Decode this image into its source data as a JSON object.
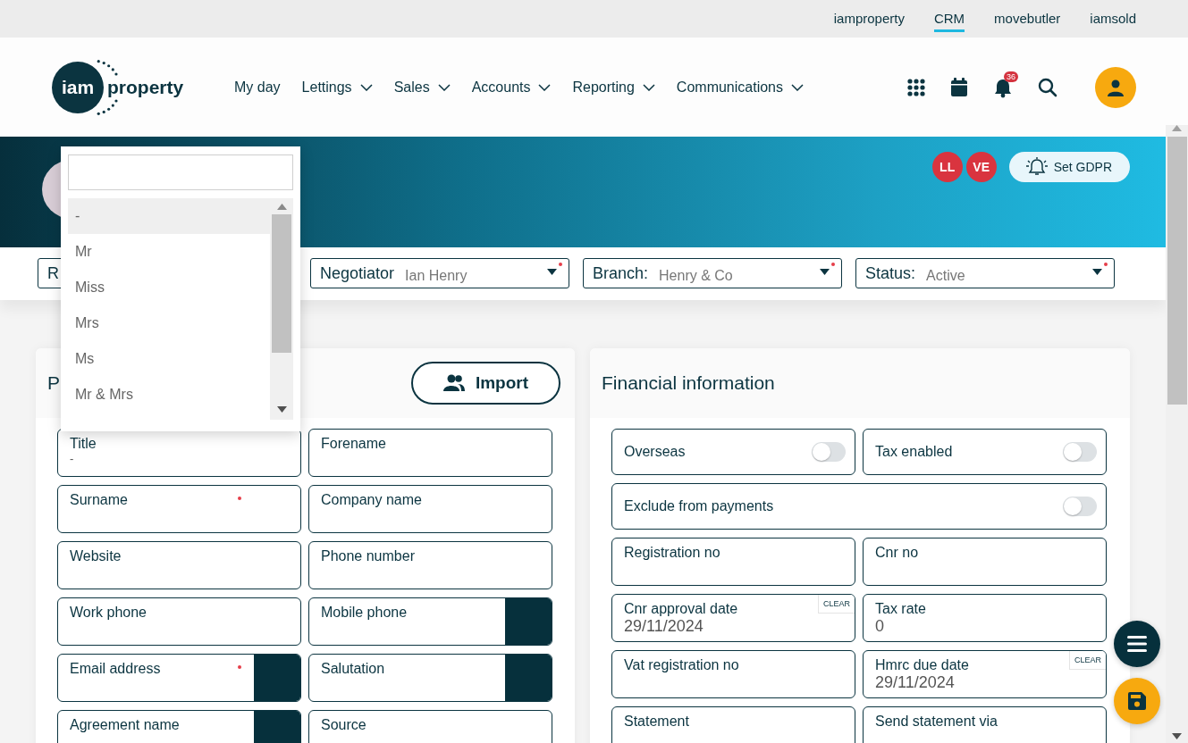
{
  "top_links": [
    {
      "label": "iamproperty",
      "selected": false
    },
    {
      "label": "CRM",
      "selected": true
    },
    {
      "label": "movebutler",
      "selected": false
    },
    {
      "label": "iamsold",
      "selected": false
    }
  ],
  "logo": {
    "mark": "iam",
    "word": "property"
  },
  "nav": [
    {
      "label": "My day",
      "has_menu": false
    },
    {
      "label": "Lettings",
      "has_menu": true
    },
    {
      "label": "Sales",
      "has_menu": true
    },
    {
      "label": "Accounts",
      "has_menu": true
    },
    {
      "label": "Reporting",
      "has_menu": true
    },
    {
      "label": "Communications",
      "has_menu": true
    }
  ],
  "notification_count": "36",
  "header": {
    "badges": [
      "LL",
      "VE"
    ],
    "gdpr_button": "Set GDPR"
  },
  "selects": [
    {
      "label": "R",
      "required": false
    },
    {
      "label": "Negotiator",
      "value": "Ian Henry",
      "required": true
    },
    {
      "label": "Branch:",
      "value": "Henry & Co",
      "required": true
    },
    {
      "label": "Status:",
      "value": "Active",
      "required": true
    }
  ],
  "personal_card": {
    "title": "P",
    "import_button": "Import",
    "fields": [
      {
        "kind": "text",
        "label": "Title",
        "value": "-",
        "required": false,
        "action_button": false
      },
      {
        "kind": "text",
        "label": "Forename",
        "required": false,
        "action_button": false
      },
      {
        "kind": "text",
        "label": "Surname",
        "required": true,
        "action_button": false
      },
      {
        "kind": "text",
        "label": "Company name",
        "required": false,
        "action_button": false
      },
      {
        "kind": "text",
        "label": "Website",
        "required": false,
        "action_button": false
      },
      {
        "kind": "text",
        "label": "Phone number",
        "required": false,
        "action_button": false
      },
      {
        "kind": "text",
        "label": "Work phone",
        "required": false,
        "action_button": false
      },
      {
        "kind": "text",
        "label": "Mobile phone",
        "required": false,
        "action_button": true
      },
      {
        "kind": "text",
        "label": "Email address",
        "required": true,
        "action_button": true
      },
      {
        "kind": "text",
        "label": "Salutation",
        "required": false,
        "action_button": true
      },
      {
        "kind": "text",
        "label": "Agreement name",
        "required": false,
        "action_button": true
      },
      {
        "kind": "text",
        "label": "Source",
        "required": false,
        "action_button": false
      }
    ]
  },
  "financial_card": {
    "title": "Financial information",
    "fields": [
      {
        "kind": "toggle",
        "label": "Overseas",
        "on": false
      },
      {
        "kind": "toggle",
        "label": "Tax enabled",
        "on": false
      },
      {
        "kind": "toggle",
        "label": "Exclude from payments",
        "on": false,
        "wide": true
      },
      {
        "kind": "text",
        "label": "Registration no"
      },
      {
        "kind": "text",
        "label": "Cnr no"
      },
      {
        "kind": "date",
        "label": "Cnr approval date",
        "value": "29/11/2024",
        "clear": "CLEAR"
      },
      {
        "kind": "text",
        "label": "Tax rate",
        "value": "0"
      },
      {
        "kind": "text",
        "label": "Vat registration no"
      },
      {
        "kind": "date",
        "label": "Hmrc due date",
        "value": "29/11/2024",
        "clear": "CLEAR"
      },
      {
        "kind": "text",
        "label": "Statement"
      },
      {
        "kind": "text",
        "label": "Send statement via"
      }
    ]
  },
  "title_dropdown": {
    "options": [
      {
        "label": "-",
        "selected": true
      },
      {
        "label": "Mr",
        "selected": false
      },
      {
        "label": "Miss",
        "selected": false
      },
      {
        "label": "Mrs",
        "selected": false
      },
      {
        "label": "Ms",
        "selected": false
      },
      {
        "label": "Mr & Mrs",
        "selected": false
      }
    ]
  }
}
